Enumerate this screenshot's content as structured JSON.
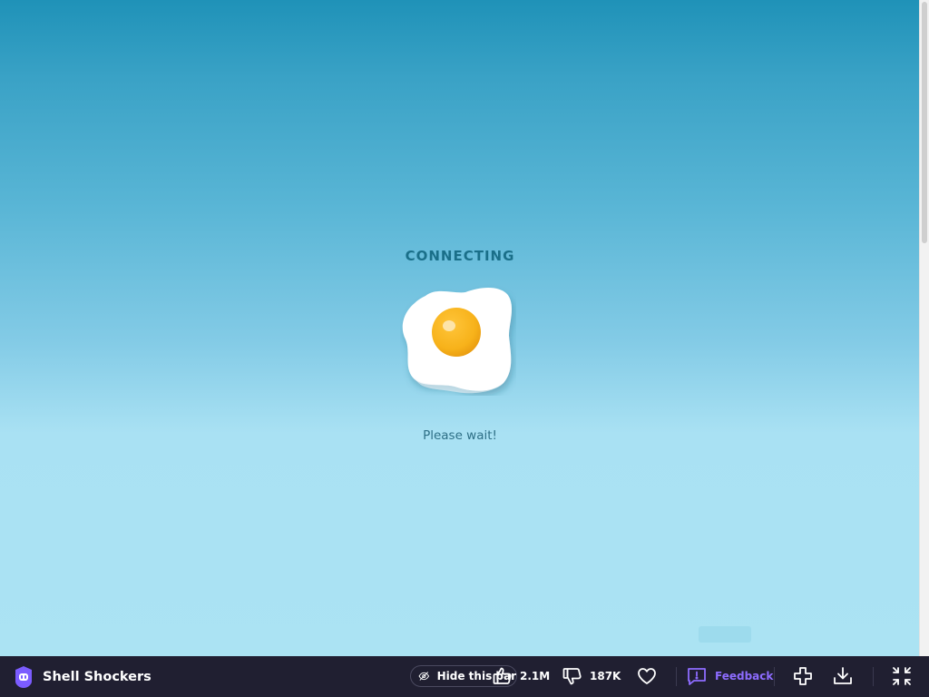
{
  "loading": {
    "title": "CONNECTING",
    "message": "Please wait!",
    "icon": "fried-egg-icon"
  },
  "bottom_bar": {
    "game_title": "Shell Shockers",
    "hide_bar_label": "Hide this bar",
    "likes": "2.1M",
    "dislikes": "187K",
    "feedback_label": "Feedback"
  },
  "colors": {
    "title": "#1a6f89",
    "message": "#2e6f86",
    "bar_background": "#201f31",
    "accent": "#8d6cff",
    "egg_yolk": "#f7b21a"
  }
}
